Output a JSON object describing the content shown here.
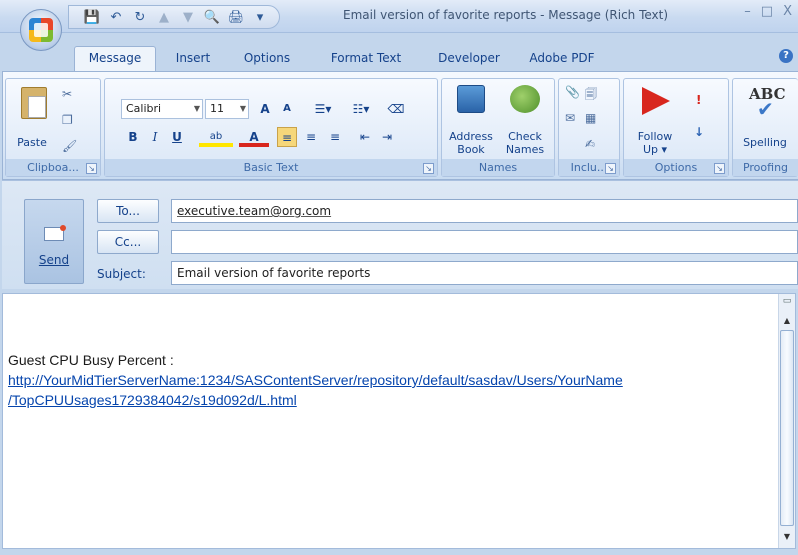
{
  "window": {
    "title": "Email version of favorite reports  - Message (Rich Text)",
    "controls": {
      "minimize": "–",
      "maximize": "□",
      "close": "X"
    }
  },
  "quick_access": {
    "save": "💾",
    "undo": "↶",
    "redo": "↻",
    "up": "▲",
    "down": "▼",
    "preview": "🔍",
    "print": "🖨",
    "customize": "▾"
  },
  "tabs": [
    "Message",
    "Insert",
    "Options",
    "Format Text",
    "Developer",
    "Adobe PDF"
  ],
  "active_tab": "Message",
  "help": "?",
  "ribbon": {
    "clipboard": {
      "title": "Clipboa...",
      "paste": "Paste"
    },
    "basic_text": {
      "title": "Basic Text",
      "font_name": "Calibri",
      "font_size": "11",
      "grow": "A",
      "shrink": "A",
      "bold": "B",
      "italic": "I",
      "underline": "U",
      "highlight": "ab",
      "font_color": "A"
    },
    "names": {
      "title": "Names",
      "address_book": [
        "Address",
        "Book"
      ],
      "check_names": [
        "Check",
        "Names"
      ]
    },
    "include": {
      "title": "Inclu..."
    },
    "options": {
      "title": "Options",
      "follow_up": [
        "Follow",
        "Up ▾"
      ],
      "high_importance": "!",
      "low_importance": "↓"
    },
    "proofing": {
      "title": "Proofing",
      "spelling": "Spelling",
      "abc": "ABC"
    }
  },
  "header": {
    "send": "Send",
    "to_label": "To...",
    "cc_label": "Cc...",
    "subject_label": "Subject:",
    "to_value": "executive.team@org.com",
    "cc_value": "",
    "subject_value": "Email version of favorite reports"
  },
  "body": {
    "line1": "Guest CPU Busy Percent :",
    "link_line1": "http://YourMidTierServerName:1234/SASContentServer/repository/default/sasdav/Users/YourName",
    "link_line2": "/TopCPUUsages1729384042/s19d092d/L.html"
  }
}
